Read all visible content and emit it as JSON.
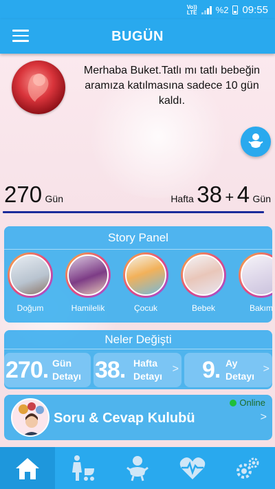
{
  "status_bar": {
    "network_label_top": "Vo))",
    "network_label_bottom": "LTE",
    "battery": "%2",
    "time": "09:55"
  },
  "app_bar": {
    "title": "BUGÜN",
    "menu_icon": "hamburger-menu-icon"
  },
  "greeting": "Merhaba Buket.Tatlı mı tatlı bebeğin aramıza katılmasına sadece 10 gün kaldı.",
  "pregnancy": {
    "days": "270",
    "days_unit": "Gün",
    "week_label": "Hafta",
    "weeks": "38",
    "plus": "+",
    "extra_days": "4",
    "extra_unit": "Gün"
  },
  "story_panel": {
    "title": "Story Panel",
    "items": [
      {
        "label": "Doğum"
      },
      {
        "label": "Hamilelik"
      },
      {
        "label": "Çocuk"
      },
      {
        "label": "Bebek"
      },
      {
        "label": "Bakım"
      }
    ]
  },
  "changes_panel": {
    "title": "Neler Değişti",
    "cards": [
      {
        "number": "270.",
        "line1": "Gün",
        "line2": "Detayı"
      },
      {
        "number": "38.",
        "line1": "Hafta",
        "line2": "Detayı"
      },
      {
        "number": "9.",
        "line1": "Ay",
        "line2": "Detayı"
      }
    ]
  },
  "club": {
    "title": "Soru & Cevap Kulubü",
    "status": "Online"
  },
  "bottom_nav": [
    {
      "icon": "home-icon",
      "active": true
    },
    {
      "icon": "mother-stroller-icon",
      "active": false
    },
    {
      "icon": "baby-icon",
      "active": false
    },
    {
      "icon": "heart-pulse-icon",
      "active": false
    },
    {
      "icon": "settings-gears-icon",
      "active": false
    }
  ],
  "colors": {
    "primary": "#29a9ee",
    "progress_line": "#1a2a9a",
    "online_dot": "#1fbf3a"
  }
}
